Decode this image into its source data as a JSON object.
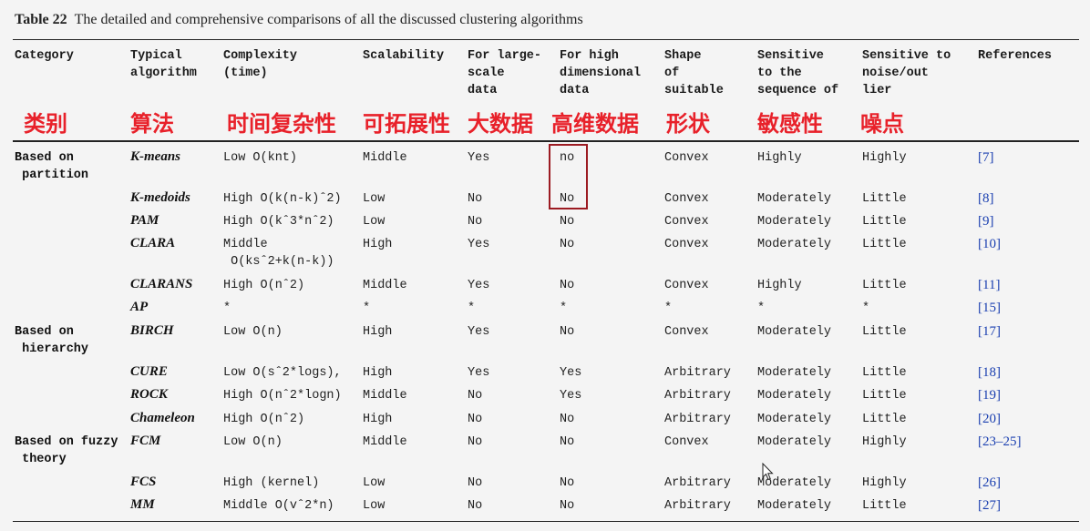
{
  "caption": {
    "number": "Table 22",
    "title": "The detailed and comprehensive comparisons of all the discussed clustering algorithms"
  },
  "headers": [
    {
      "en": "Category",
      "cn": "类别"
    },
    {
      "en": "Typical\nalgorithm",
      "cn": "算法"
    },
    {
      "en": "Complexity\n(time)",
      "cn": "时间复杂性"
    },
    {
      "en": "Scalability",
      "cn": "可拓展性"
    },
    {
      "en": "For large-\nscale\ndata",
      "cn": "大数据"
    },
    {
      "en": "For high\ndimensional\ndata",
      "cn": "高维数据"
    },
    {
      "en": "Shape\nof\nsuitable",
      "cn": "形状"
    },
    {
      "en": "Sensitive\nto the\nsequence of",
      "cn": "敏感性"
    },
    {
      "en": "Sensitive to\nnoise/out\nlier",
      "cn": "噪点"
    },
    {
      "en": "References",
      "cn": ""
    }
  ],
  "categories": [
    {
      "label": "Based on\n partition"
    },
    {
      "label": "Based on\n hierarchy"
    },
    {
      "label": "Based on fuzzy\n theory"
    }
  ],
  "rows": [
    {
      "alg": "K-means",
      "complexity": "Low O(knt)",
      "scalability": "Middle",
      "large": "Yes",
      "high": "no",
      "shape": "Convex",
      "sequence": "Highly",
      "noise": "Highly",
      "ref": "[7]"
    },
    {
      "alg": "K-medoids",
      "complexity": "High O(k(n-k)ˆ2)",
      "scalability": "Low",
      "large": "No",
      "high": "No",
      "shape": "Convex",
      "sequence": "Moderately",
      "noise": "Little",
      "ref": "[8]"
    },
    {
      "alg": "PAM",
      "complexity": "High O(kˆ3*nˆ2)",
      "scalability": "Low",
      "large": "No",
      "high": "No",
      "shape": "Convex",
      "sequence": "Moderately",
      "noise": "Little",
      "ref": "[9]"
    },
    {
      "alg": "CLARA",
      "complexity": "Middle\n O(ksˆ2+k(n-k))",
      "scalability": "High",
      "large": "Yes",
      "high": "No",
      "shape": "Convex",
      "sequence": "Moderately",
      "noise": "Little",
      "ref": "[10]"
    },
    {
      "alg": "CLARANS",
      "complexity": "High O(nˆ2)",
      "scalability": "Middle",
      "large": "Yes",
      "high": "No",
      "shape": "Convex",
      "sequence": "Highly",
      "noise": "Little",
      "ref": "[11]"
    },
    {
      "alg": "AP",
      "complexity": "*",
      "scalability": "*",
      "large": "*",
      "high": "*",
      "shape": "*",
      "sequence": "*",
      "noise": "*",
      "ref": "[15]"
    },
    {
      "alg": "BIRCH",
      "complexity": "Low O(n)",
      "scalability": "High",
      "large": "Yes",
      "high": "No",
      "shape": "Convex",
      "sequence": "Moderately",
      "noise": "Little",
      "ref": "[17]"
    },
    {
      "alg": "CURE",
      "complexity": "Low O(sˆ2*logs),",
      "scalability": "High",
      "large": "Yes",
      "high": "Yes",
      "shape": "Arbitrary",
      "sequence": "Moderately",
      "noise": "Little",
      "ref": "[18]"
    },
    {
      "alg": "ROCK",
      "complexity": "High O(nˆ2*logn)",
      "scalability": "Middle",
      "large": "No",
      "high": "Yes",
      "shape": "Arbitrary",
      "sequence": "Moderately",
      "noise": "Little",
      "ref": "[19]"
    },
    {
      "alg": "Chameleon",
      "complexity": "High O(nˆ2)",
      "scalability": "High",
      "large": "No",
      "high": "No",
      "shape": "Arbitrary",
      "sequence": "Moderately",
      "noise": "Little",
      "ref": "[20]"
    },
    {
      "alg": "FCM",
      "complexity": "Low O(n)",
      "scalability": "Middle",
      "large": "No",
      "high": "No",
      "shape": "Convex",
      "sequence": "Moderately",
      "noise": "Highly",
      "ref": "[23–25]"
    },
    {
      "alg": "FCS",
      "complexity": "High (kernel)",
      "scalability": "Low",
      "large": "No",
      "high": "No",
      "shape": "Arbitrary",
      "sequence": "Moderately",
      "noise": "Highly",
      "ref": "[26]"
    },
    {
      "alg": "MM",
      "complexity": "Middle O(vˆ2*n)",
      "scalability": "Low",
      "large": "No",
      "high": "No",
      "shape": "Arbitrary",
      "sequence": "Moderately",
      "noise": "Little",
      "ref": "[27]"
    }
  ],
  "colors": {
    "annotation": "#e8212a",
    "highlight_box": "#9c1b22",
    "reference_link": "#1a3fb0"
  },
  "icons": {
    "cursor": "mouse-pointer-icon"
  }
}
